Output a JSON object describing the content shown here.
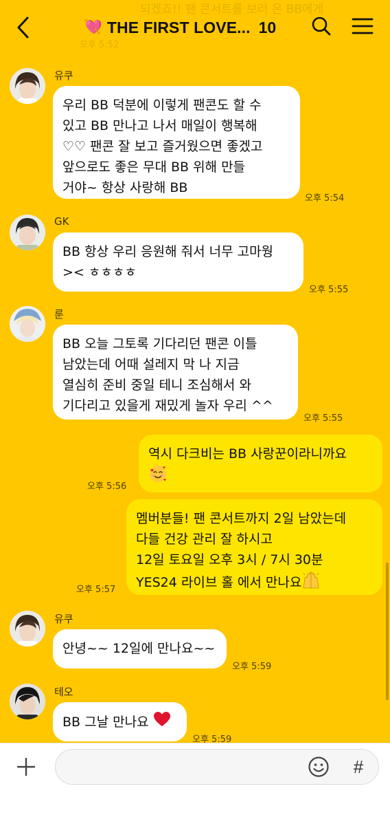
{
  "header": {
    "ghost_text": "되겠죠!! 팬 콘서트를 보러 온 BB에게",
    "ghost_time": "오후 5:52",
    "title": "THE FIRST LOVE...",
    "member_count": "10"
  },
  "messages": [
    {
      "sender": "유쿠",
      "lines": [
        "우리 BB 덕분에 이렇게 팬콘도 할 수",
        "있고 BB 만나고 나서 매일이 행복해",
        "♡♡ 팬콘 잘 보고 즐거웠으면 좋겠고",
        "앞으로도 좋은 무대 BB 위해 만들",
        "거야~ 항상 사랑해 BB"
      ],
      "time": "오후 5:54"
    },
    {
      "sender": "GK",
      "lines": [
        "BB 항상 우리 응원해 줘서 너무 고마웡",
        "><  ㅎㅎㅎㅎ"
      ],
      "time": "오후 5:55"
    },
    {
      "sender": "룬",
      "lines": [
        "BB 오늘 그토록 기다리던 팬콘 이틀",
        "남았는데 어때 설레지 막 나 지금",
        "열심히 준비 중일 테니 조심해서 와",
        "기다리고 있을게 재밌게 놀자 우리 ^^"
      ],
      "time": "오후 5:55"
    },
    {
      "sender": "",
      "lines": [
        "역시 다크비는 BB 사랑꾼이라니까요"
      ],
      "time": "오후 5:56"
    },
    {
      "sender": "",
      "lines": [
        "멤버분들! 팬 콘서트까지 2일 남았는데",
        "다들 건강 관리 잘 하시고",
        "12일 토요일 오후 3시 / 7시 30분",
        "YES24 라이브 홀 에서 만나요"
      ],
      "time": "오후 5:57"
    },
    {
      "sender": "유쿠",
      "lines": [
        "안녕~~ 12일에 만나요~~"
      ],
      "time": "오후 5:59"
    },
    {
      "sender": "테오",
      "lines": [
        "BB 그날 만나요"
      ],
      "time": "오후 5:59"
    }
  ],
  "input": {
    "value": "",
    "plus_icon": "plus-icon",
    "emoji_icon": "smile-icon",
    "hash_label": "#"
  },
  "colors": {
    "background": "#FFC700",
    "bubble_in": "#FFFFFF",
    "bubble_out": "#FEE500",
    "heart": "#E0142E"
  }
}
